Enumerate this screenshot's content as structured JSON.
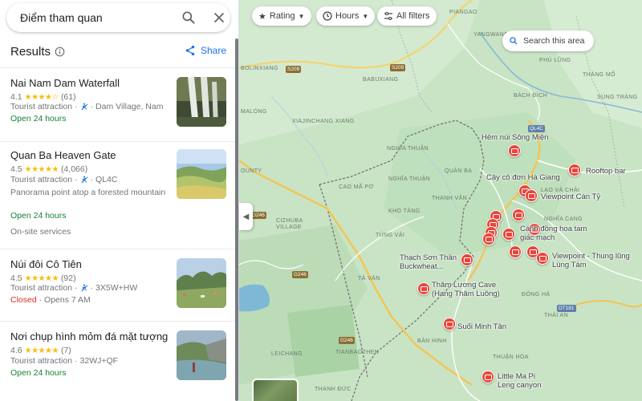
{
  "search": {
    "query": "Điểm tham quan"
  },
  "results_panel": {
    "title": "Results",
    "share_label": "Share"
  },
  "results": [
    {
      "name": "Nai Nam Dam Waterfall",
      "rating": "4.1",
      "stars": "★★★★☆",
      "reviews": "(61)",
      "category": "Tourist attraction",
      "address": "Dam Village, Nam",
      "status": "Open 24 hours"
    },
    {
      "name": "Quan Ba Heaven Gate",
      "rating": "4.5",
      "stars": "★★★★★",
      "reviews": "(4,066)",
      "category": "Tourist attraction",
      "address": "QL4C",
      "description": "Panorama point atop a forested mountain",
      "status": "Open 24 hours",
      "extra": "On-site services"
    },
    {
      "name": "Núi đôi Cô Tiên",
      "rating": "4.5",
      "stars": "★★★★★",
      "reviews": "(92)",
      "category": "Tourist attraction",
      "address": "3X5W+HW",
      "closed": "Closed",
      "opens": "· Opens 7 AM"
    },
    {
      "name": "Nơi chụp hình mỏm đá mặt tượng",
      "rating": "4.6",
      "stars": "★★★★★",
      "reviews": "(7)",
      "category": "Tourist attraction",
      "address": "32WJ+QF",
      "status": "Open 24 hours"
    }
  ],
  "filters": {
    "rating": "Rating",
    "hours": "Hours",
    "all": "All filters"
  },
  "map": {
    "search_area": "Search this area",
    "pins": [
      {
        "label": "Hẻm núi Sông Miện"
      },
      {
        "label": "Rooftop bar"
      },
      {
        "label": "Cây cô đơn Hà Giang"
      },
      {
        "label": "Viewpoint Cán Tỷ"
      },
      {
        "label": "Cánh đồng hoa tam giác mạch"
      },
      {
        "label": "Viewpoint - Thung lũng Lùng Tám"
      },
      {
        "label": "Thạch Sơn Thần Buckwheat..."
      },
      {
        "label": "Thăm Lương Cave (Hang Thăm Luồng)"
      },
      {
        "label": "Suối Minh Tân"
      },
      {
        "label": "Little Ma Pi Leng canyon"
      }
    ],
    "places": [
      "PIANGAO",
      "YANGWANG",
      "PHÚ LŨNG",
      "THÁNG MỐ",
      "BÁCH ĐÍCH",
      "SÚNG TRÁNG",
      "BOLINXIANG",
      "BABUXIANG",
      "XIAJINCHANG XIANG",
      "NGHĨA THUẬN",
      "CAO MÃ PỜ",
      "KHO TÀNG",
      "THANH VÂN",
      "TÙNG VÀI",
      "LAO VÀ CHẢI",
      "NGHĨA THUẬN",
      "CIZHUBA VILLAGE",
      "TẢ VÁN",
      "ĐÔNG HÀ",
      "THÁI AN",
      "BẢN HINH",
      "THUẬN HÒA",
      "LEICHANG",
      "TIANBAOZHEN",
      "THANH ĐỨC",
      "MALONG",
      "NGHĨA CANG",
      "QUẢN BẠ",
      "OUNTY"
    ],
    "shields": [
      "S209",
      "S209",
      "QL4C",
      "G246",
      "G246",
      "G246",
      "DT181"
    ]
  }
}
